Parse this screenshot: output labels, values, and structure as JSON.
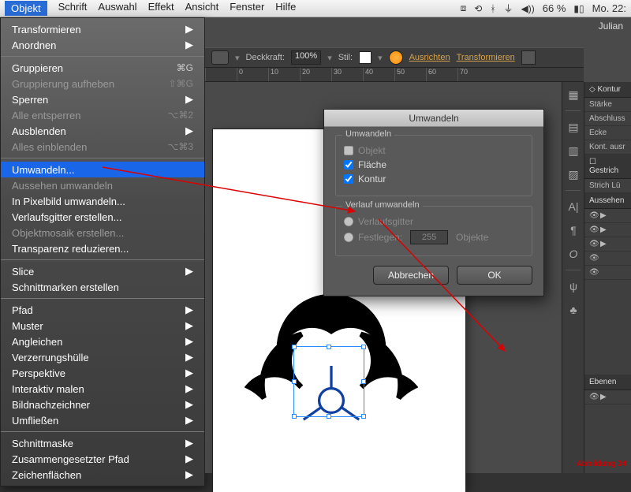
{
  "os_menu": {
    "items": [
      "Objekt",
      "Schrift",
      "Auswahl",
      "Effekt",
      "Ansicht",
      "Fenster",
      "Hilfe"
    ],
    "active_index": 0,
    "status": {
      "battery": "66 %",
      "clock": "Mo. 22:"
    }
  },
  "doc_title": "Julian",
  "dropdown": {
    "groups": [
      [
        {
          "label": "Transformieren",
          "sub": true
        },
        {
          "label": "Anordnen",
          "sub": true
        }
      ],
      [
        {
          "label": "Gruppieren",
          "shortcut": "⌘G"
        },
        {
          "label": "Gruppierung aufheben",
          "shortcut": "⇧⌘G",
          "disabled": true
        },
        {
          "label": "Sperren",
          "sub": true
        },
        {
          "label": "Alle entsperren",
          "shortcut": "⌥⌘2",
          "disabled": true
        },
        {
          "label": "Ausblenden",
          "sub": true
        },
        {
          "label": "Alles einblenden",
          "shortcut": "⌥⌘3",
          "disabled": true
        }
      ],
      [
        {
          "label": "Umwandeln...",
          "selected": true
        },
        {
          "label": "Aussehen umwandeln",
          "disabled": true
        },
        {
          "label": "In Pixelbild umwandeln..."
        },
        {
          "label": "Verlaufsgitter erstellen..."
        },
        {
          "label": "Objektmosaik erstellen...",
          "disabled": true
        },
        {
          "label": "Transparenz reduzieren..."
        }
      ],
      [
        {
          "label": "Slice",
          "sub": true
        },
        {
          "label": "Schnittmarken erstellen"
        }
      ],
      [
        {
          "label": "Pfad",
          "sub": true
        },
        {
          "label": "Muster",
          "sub": true
        },
        {
          "label": "Angleichen",
          "sub": true
        },
        {
          "label": "Verzerrungshülle",
          "sub": true
        },
        {
          "label": "Perspektive",
          "sub": true
        },
        {
          "label": "Interaktiv malen",
          "sub": true
        },
        {
          "label": "Bildnachzeichner",
          "sub": true
        },
        {
          "label": "Umfließen",
          "sub": true
        }
      ],
      [
        {
          "label": "Schnittmaske",
          "sub": true
        },
        {
          "label": "Zusammengesetzter Pfad",
          "sub": true
        },
        {
          "label": "Zeichenflächen",
          "sub": true
        }
      ]
    ]
  },
  "ctrlbar": {
    "opacity_label": "Deckkraft:",
    "opacity_value": "100%",
    "style_label": "Stil:",
    "link_align": "Ausrichten",
    "link_transform": "Transformieren"
  },
  "ruler_ticks": [
    "",
    "0",
    "10",
    "20",
    "30",
    "40",
    "50",
    "60",
    "70"
  ],
  "dialog": {
    "title": "Umwandeln",
    "group1_legend": "Umwandeln",
    "chk_object": "Objekt",
    "chk_fill": "Fläche",
    "chk_stroke": "Kontur",
    "group2_legend": "Verlauf umwandeln",
    "radio_mesh": "Verlaufsgitter",
    "radio_specify": "Festlegen:",
    "specify_value": "255",
    "specify_unit": "Objekte",
    "btn_cancel": "Abbrechen",
    "btn_ok": "OK"
  },
  "right_panel": {
    "hdr_kontur": "Kontur",
    "row_staerke": "Stärke",
    "row_abschluss": "Abschluss",
    "row_ecke": "Ecke",
    "row_kontausr": "Kont. ausr",
    "hdr_gestrich": "Gestrich",
    "row_strich": "Strich",
    "row_lue": "Lü",
    "hdr_aussehen": "Aussehen",
    "hdr_ebenen": "Ebenen"
  },
  "footer_label": "Abbildung 34"
}
